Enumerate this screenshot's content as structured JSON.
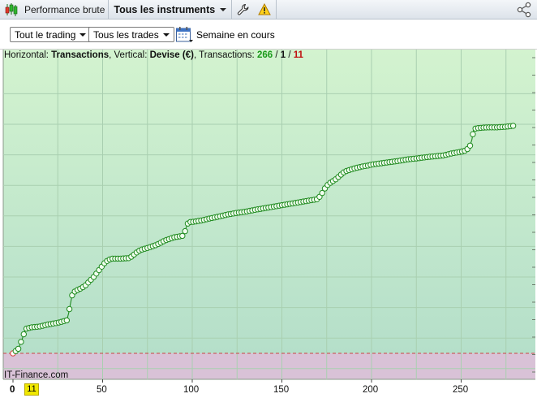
{
  "toolbar": {
    "title": "Performance brute",
    "instruments": "Tous les instruments"
  },
  "filters": {
    "trading": "Tout le trading",
    "trades": "Tous les trades",
    "period": "Semaine en cours"
  },
  "info": {
    "horizontal_label": "Horizontal: ",
    "horizontal_value": "Transactions",
    "vertical_label": ", Vertical: ",
    "vertical_value": "Devise (€)",
    "transactions_label": ", Transactions: ",
    "winning": "266",
    "sep1": " / ",
    "neutral": "1",
    "sep2": " / ",
    "losing": "11"
  },
  "brand": "IT-Finance.com",
  "colors": {
    "profit_zone_top": "#d2f2cf",
    "profit_zone_bottom": "#b4e0c9",
    "loss_zone": "#d9c2d7",
    "curve": "#1f8a1f",
    "marker_fill": "#f2fff0",
    "first_marker": "#d93a3a",
    "zero_line": "#cc4444"
  },
  "chart_data": {
    "type": "line",
    "xlabel": "",
    "ylabel": "",
    "x_ticks": [
      "0",
      "11",
      "50",
      "100",
      "150",
      "200",
      "250"
    ],
    "highlighted_tick": "11",
    "xlim": [
      0,
      290
    ],
    "ylim": [
      -0.6,
      6.5
    ],
    "grid": true,
    "baseline": 0,
    "series": [
      {
        "x": [
          0,
          3,
          5,
          7,
          10,
          15,
          20,
          25,
          30,
          31,
          32,
          33,
          34,
          35,
          37,
          40,
          45,
          47,
          49,
          51,
          53,
          55,
          57,
          60,
          65,
          70,
          72,
          75,
          80,
          85,
          90,
          95,
          96,
          97,
          98,
          100,
          105,
          110,
          115,
          120,
          125,
          130,
          135,
          140,
          145,
          150,
          155,
          160,
          165,
          170,
          172,
          174,
          176,
          178,
          180,
          182,
          185,
          190,
          195,
          198,
          200,
          205,
          210,
          215,
          220,
          225,
          230,
          235,
          240,
          245,
          250,
          253,
          255,
          256,
          257,
          260,
          265,
          270,
          275,
          279
        ],
        "y": [
          0.0,
          0.15,
          0.45,
          0.8,
          0.85,
          0.88,
          0.95,
          1.0,
          1.08,
          1.3,
          1.6,
          1.9,
          2.0,
          2.05,
          2.1,
          2.2,
          2.5,
          2.65,
          2.8,
          2.95,
          3.05,
          3.1,
          3.1,
          3.1,
          3.12,
          3.35,
          3.4,
          3.45,
          3.55,
          3.7,
          3.8,
          3.85,
          4.0,
          4.2,
          4.3,
          4.3,
          4.35,
          4.42,
          4.48,
          4.55,
          4.6,
          4.64,
          4.7,
          4.75,
          4.8,
          4.85,
          4.9,
          4.95,
          5.0,
          5.05,
          5.2,
          5.4,
          5.55,
          5.62,
          5.7,
          5.8,
          5.95,
          6.05,
          6.12,
          6.15,
          6.18,
          6.22,
          6.26,
          6.3,
          6.35,
          6.38,
          6.42,
          6.45,
          6.48,
          6.55,
          6.6,
          6.65,
          6.8,
          7.0,
          7.35,
          7.38,
          7.4,
          7.4,
          7.42,
          7.45
        ]
      }
    ]
  }
}
